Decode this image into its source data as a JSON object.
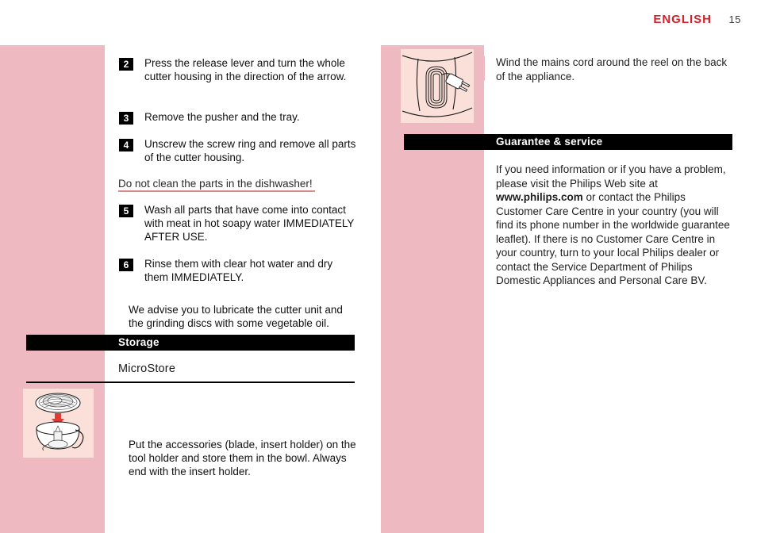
{
  "header": {
    "language": "ENGLISH",
    "page_number": "15"
  },
  "colors": {
    "pink_margin": "#eeb9c0",
    "illustration_bg": "#fae0d8",
    "header_red": "#d3202a",
    "warning_underline": "#d98a8a",
    "section_bar": "#000000"
  },
  "left_column": {
    "steps": [
      {
        "number": "2",
        "text": "Press the release lever and turn the whole cutter housing in the direction of the arrow."
      },
      {
        "number": "3",
        "text": "Remove the pusher and the tray."
      },
      {
        "number": "4",
        "text": "Unscrew the screw ring and remove all parts of the cutter housing."
      }
    ],
    "warning": "Do not clean the parts in the dishwasher!",
    "steps_after_warning": [
      {
        "number": "5",
        "text": "Wash all parts that have come into contact with meat in hot soapy water IMMEDIATELY AFTER USE."
      },
      {
        "number": "6",
        "text": "Rinse them with clear hot water and dry them IMMEDIATELY."
      }
    ],
    "advice": "We advise you to lubricate the cutter unit and the grinding discs with some vegetable oil.",
    "section_heading": "Storage",
    "sub_heading": "MicroStore",
    "microstore_text": "Put the accessories (blade, insert holder) on the tool holder and store them in the bowl. Always end with the insert holder.",
    "illustration_name": "food-processor-bowl-with-disc-illustration"
  },
  "right_column": {
    "cord_text": "Wind the mains cord around the reel on the back of the appliance.",
    "illustration_name": "appliance-cord-reel-with-plug-illustration",
    "section_heading": "Guarantee & service",
    "guarantee_before_link": "If you need information or if you have a problem, please visit the Philips Web site at ",
    "guarantee_link": "www.philips.com",
    "guarantee_after_link": " or contact the Philips Customer Care Centre in your country (you will find its phone number in the worldwide guarantee leaflet). If there is no Customer Care Centre in your country, turn to your local Philips dealer or contact the Service Department of Philips Domestic Appliances and Personal Care BV."
  }
}
